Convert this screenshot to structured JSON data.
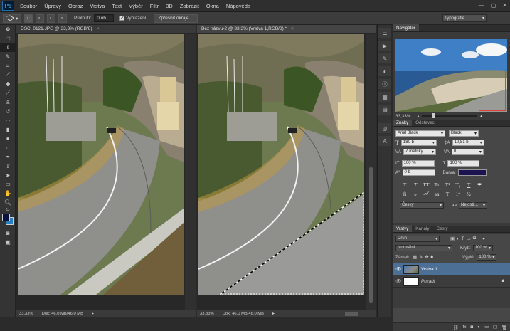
{
  "app": {
    "logo": "Ps"
  },
  "menu": [
    "Soubor",
    "Úpravy",
    "Obraz",
    "Vrstva",
    "Text",
    "Výběr",
    "Filtr",
    "3D",
    "Zobrazit",
    "Okna",
    "Nápověda"
  ],
  "options": {
    "feather_label": "Prolnutí:",
    "feather_value": "0 ob",
    "antialias_label": "Vyhlazení",
    "refine_button": "Zpřesnit okraje...",
    "workspace": "Typografie"
  },
  "docs": [
    {
      "tab": "DSC_0121.JPG @ 33,3% (RGB/8)",
      "zoom": "33,33%",
      "status": "Dok: 46,0 MB/46,0 MB"
    },
    {
      "tab": "Bez názvu-2 @ 33,3% (Vrstva 1,RGB/8) *",
      "zoom": "33,33%",
      "status": "Dok: 46,0 MB/46,0 MB"
    }
  ],
  "navigator": {
    "title": "Navigátor",
    "zoom": "33,33%"
  },
  "character": {
    "tabs": [
      "Znaky",
      "Odstavec"
    ],
    "font": "Arial Black",
    "style": "Black",
    "size": "180 b",
    "leading": "10,81 b",
    "kerning": "Z metriky",
    "tracking": "0",
    "vscale": "100 %",
    "hscale": "100 %",
    "baseline": "0 b",
    "color_label": "Barva:",
    "text_color": "#1b1450",
    "language": "Český",
    "aa": "Nejostř..."
  },
  "layers": {
    "tabs": [
      "Vrstvy",
      "Kanály",
      "Cesty"
    ],
    "filter": "Druh",
    "blend": "Normální",
    "opacity_label": "Krytí:",
    "opacity": "100 %",
    "lock_label": "Zámek:",
    "fill_label": "Výplň:",
    "fill": "100 %",
    "items": [
      {
        "name": "Vrstva 1",
        "selected": true
      },
      {
        "name": "Pozadí",
        "selected": false
      }
    ]
  },
  "colors": {
    "accent": "#4c6f95",
    "foreground": "#0a1240",
    "background": "#2a7fc0"
  }
}
